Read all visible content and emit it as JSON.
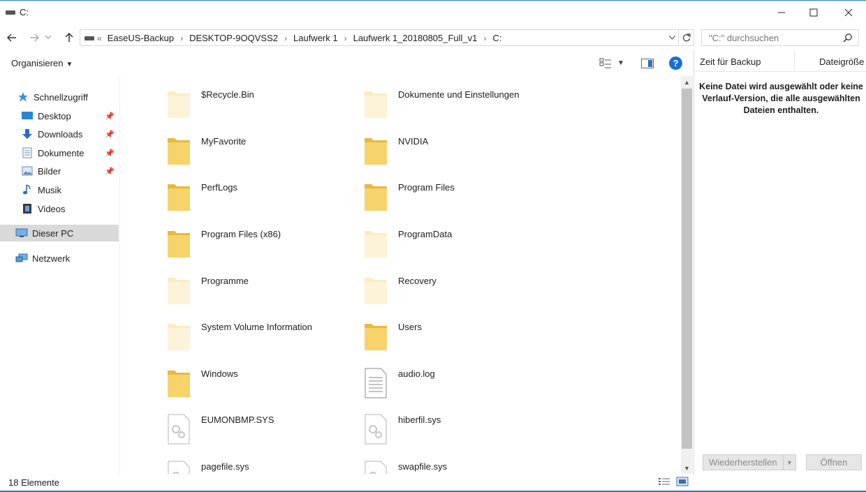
{
  "window": {
    "title": "C:"
  },
  "address": {
    "lead": "«",
    "crumbs": [
      "EaseUS-Backup",
      "DESKTOP-9OQVSS2",
      "Laufwerk 1",
      "Laufwerk 1_20180805_Full_v1",
      "C:"
    ]
  },
  "search": {
    "placeholder": "\"C:\" durchsuchen"
  },
  "toolbar": {
    "organize_label": "Organisieren"
  },
  "nav": {
    "quick_access": "Schnellzugriff",
    "desktop": "Desktop",
    "downloads": "Downloads",
    "documents": "Dokumente",
    "pictures": "Bilder",
    "music": "Musik",
    "videos": "Videos",
    "this_pc": "Dieser PC",
    "network": "Netzwerk"
  },
  "files": {
    "f1": "$Recycle.Bin",
    "f2": "Dokumente und Einstellungen",
    "f3": "MyFavorite",
    "f4": "NVIDIA",
    "f5": "PerfLogs",
    "f6": "Program Files",
    "f7": "Program Files (x86)",
    "f8": "ProgramData",
    "f9": "Programme",
    "f10": "Recovery",
    "f11": "System Volume Information",
    "f12": "Users",
    "f13": "Windows",
    "f14": "audio.log",
    "f15": "EUMONBMP.SYS",
    "f16": "hiberfil.sys",
    "f17": "pagefile.sys",
    "f18": "swapfile.sys"
  },
  "details": {
    "col_time": "Zeit für Backup",
    "col_size": "Dateigröße",
    "message": "Keine Datei wird ausgewählt oder keine Verlauf-Version, die alle ausgewählten Dateien enthalten.",
    "restore_label": "Wiederherstellen",
    "open_label": "Öffnen"
  },
  "status": {
    "count": "18 Elemente"
  },
  "colors": {
    "accent": "#2b78d0",
    "folder": "#f6d36b",
    "folder_faded": "#fbecc0"
  }
}
